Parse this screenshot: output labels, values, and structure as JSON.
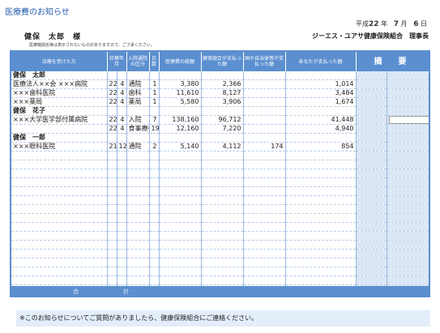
{
  "header": {
    "title": "医療費のお知らせ",
    "date_era": "平成",
    "date_year": "22",
    "year_unit": "年",
    "date_month": "7",
    "month_unit": "月",
    "date_day": "6",
    "day_unit": "日",
    "recipient": "健保　太郎　様",
    "issuer": "ジーエス・ユアサ健康保険組合　理事長",
    "note": "医療機関名等は表示されないものがありますので、ご了承ください。"
  },
  "columns": [
    "治療を受けた方",
    "診療年月",
    "入院通院の区分",
    "日数",
    "医療費の総額",
    "健保組合が支払った額",
    "国や自治体等が支払った額",
    "あなたが支払った額",
    "摘　要"
  ],
  "rows": [
    {
      "name": "健保　太郎",
      "yy": "",
      "mm": "",
      "kind": "",
      "days": "",
      "total": "",
      "insurer": "",
      "public": "",
      "paid": "",
      "is_group": true
    },
    {
      "name": "医療法人××会 ×××病院",
      "yy": "22",
      "mm": "4",
      "kind": "通院",
      "days": "1",
      "total": "3,380",
      "insurer": "2,366",
      "public": "",
      "paid": "1,014",
      "is_group": false
    },
    {
      "name": "×××歯科医院",
      "yy": "22",
      "mm": "4",
      "kind": "歯科",
      "days": "1",
      "total": "11,610",
      "insurer": "8,127",
      "public": "",
      "paid": "3,484",
      "is_group": false
    },
    {
      "name": "×××薬局",
      "yy": "22",
      "mm": "4",
      "kind": "薬局",
      "days": "1",
      "total": "5,580",
      "insurer": "3,906",
      "public": "",
      "paid": "1,674",
      "is_group": false
    },
    {
      "name": "健保　花子",
      "yy": "",
      "mm": "",
      "kind": "",
      "days": "",
      "total": "",
      "insurer": "",
      "public": "",
      "paid": "",
      "is_group": true
    },
    {
      "name": "×××大学医学部付属病院",
      "yy": "22",
      "mm": "4",
      "kind": "入院",
      "days": "7",
      "total": "138,160",
      "insurer": "96,712",
      "public": "",
      "paid": "41,448",
      "is_group": false
    },
    {
      "name": "",
      "yy": "22",
      "mm": "4",
      "kind": "食事療養",
      "days": "19",
      "total": "12,160",
      "insurer": "7,220",
      "public": "",
      "paid": "4,940",
      "is_group": false
    },
    {
      "name": "健保　一郎",
      "yy": "",
      "mm": "",
      "kind": "",
      "days": "",
      "total": "",
      "insurer": "",
      "public": "",
      "paid": "",
      "is_group": true
    },
    {
      "name": "×××眼科医院",
      "yy": "21",
      "mm": "12",
      "kind": "通院",
      "days": "2",
      "total": "5,140",
      "insurer": "4,112",
      "public": "174",
      "paid": "854",
      "is_group": false
    }
  ],
  "total_row": {
    "label1": "合",
    "label2": "計"
  },
  "footer": "※このお知らせについてご質問がありましたら、健康保険組合にご連絡ください。"
}
